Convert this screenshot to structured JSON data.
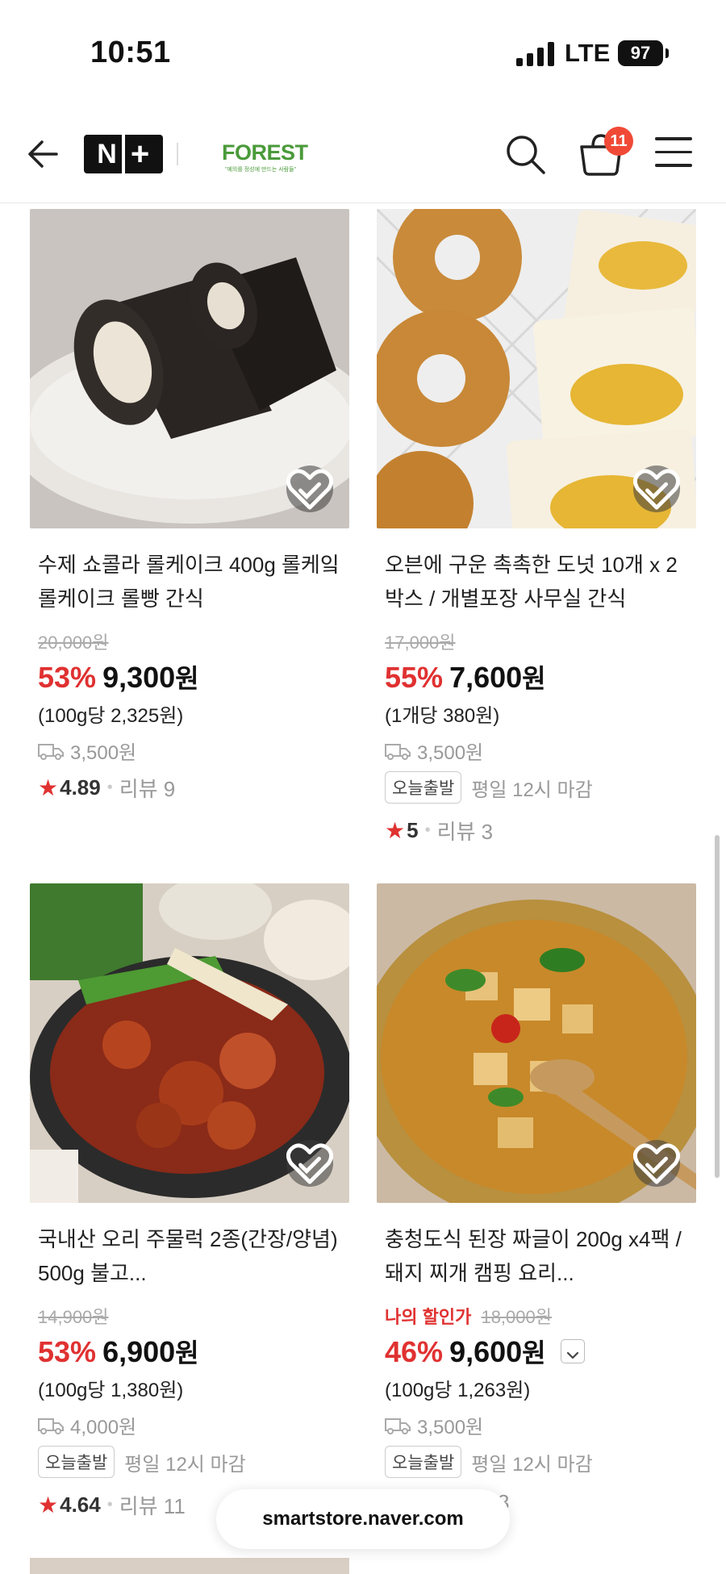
{
  "status_bar": {
    "time": "10:51",
    "network": "LTE",
    "battery": "97"
  },
  "nav": {
    "logo_left": "N",
    "logo_right": "+",
    "brand": "FOREST",
    "brand_sub": "\"예의를 정성에 만드는 사람들\"",
    "cart_count": "11"
  },
  "products": [
    {
      "title": "수제 쇼콜라 롤케이크 400g 롤케잌 롤케이크 롤빵 간식",
      "original_price": "20,000원",
      "discount": "53%",
      "price": "9,300",
      "won": "원",
      "unit_price": "(100g당 2,325원)",
      "shipping": "3,500원",
      "rating": "4.89",
      "review": "리뷰 9"
    },
    {
      "title": "오븐에 구운 촉촉한 도넛 10개 x 2박스 / 개별포장 사무실 간식",
      "original_price": "17,000원",
      "discount": "55%",
      "price": "7,600",
      "won": "원",
      "unit_price": "(1개당 380원)",
      "shipping": "3,500원",
      "today_tag": "오늘출발",
      "today_text": "평일 12시 마감",
      "rating": "5",
      "review": "리뷰 3"
    },
    {
      "title": "국내산 오리 주물럭 2종(간장/양념) 500g 불고...",
      "original_price": "14,900원",
      "discount": "53%",
      "price": "6,900",
      "won": "원",
      "unit_price": "(100g당 1,380원)",
      "shipping": "4,000원",
      "today_tag": "오늘출발",
      "today_text": "평일 12시 마감",
      "rating": "4.64",
      "review": "리뷰 11"
    },
    {
      "title": "충청도식 된장 짜글이 200g x4팩 / 돼지 찌개 캠핑 요리...",
      "my_deal_label": "나의 할인가",
      "original_price": "18,000원",
      "discount": "46%",
      "price": "9,600",
      "won": "원",
      "unit_price": "(100g당 1,263원)",
      "shipping": "3,500원",
      "today_tag": "오늘출발",
      "today_text": "평일 12시 마감",
      "review_partial": "3"
    }
  ],
  "url_pill": "smartstore.naver.com",
  "colors": {
    "discount": "#e03131",
    "brand": "#4a9a3a",
    "badge": "#f04a37"
  }
}
